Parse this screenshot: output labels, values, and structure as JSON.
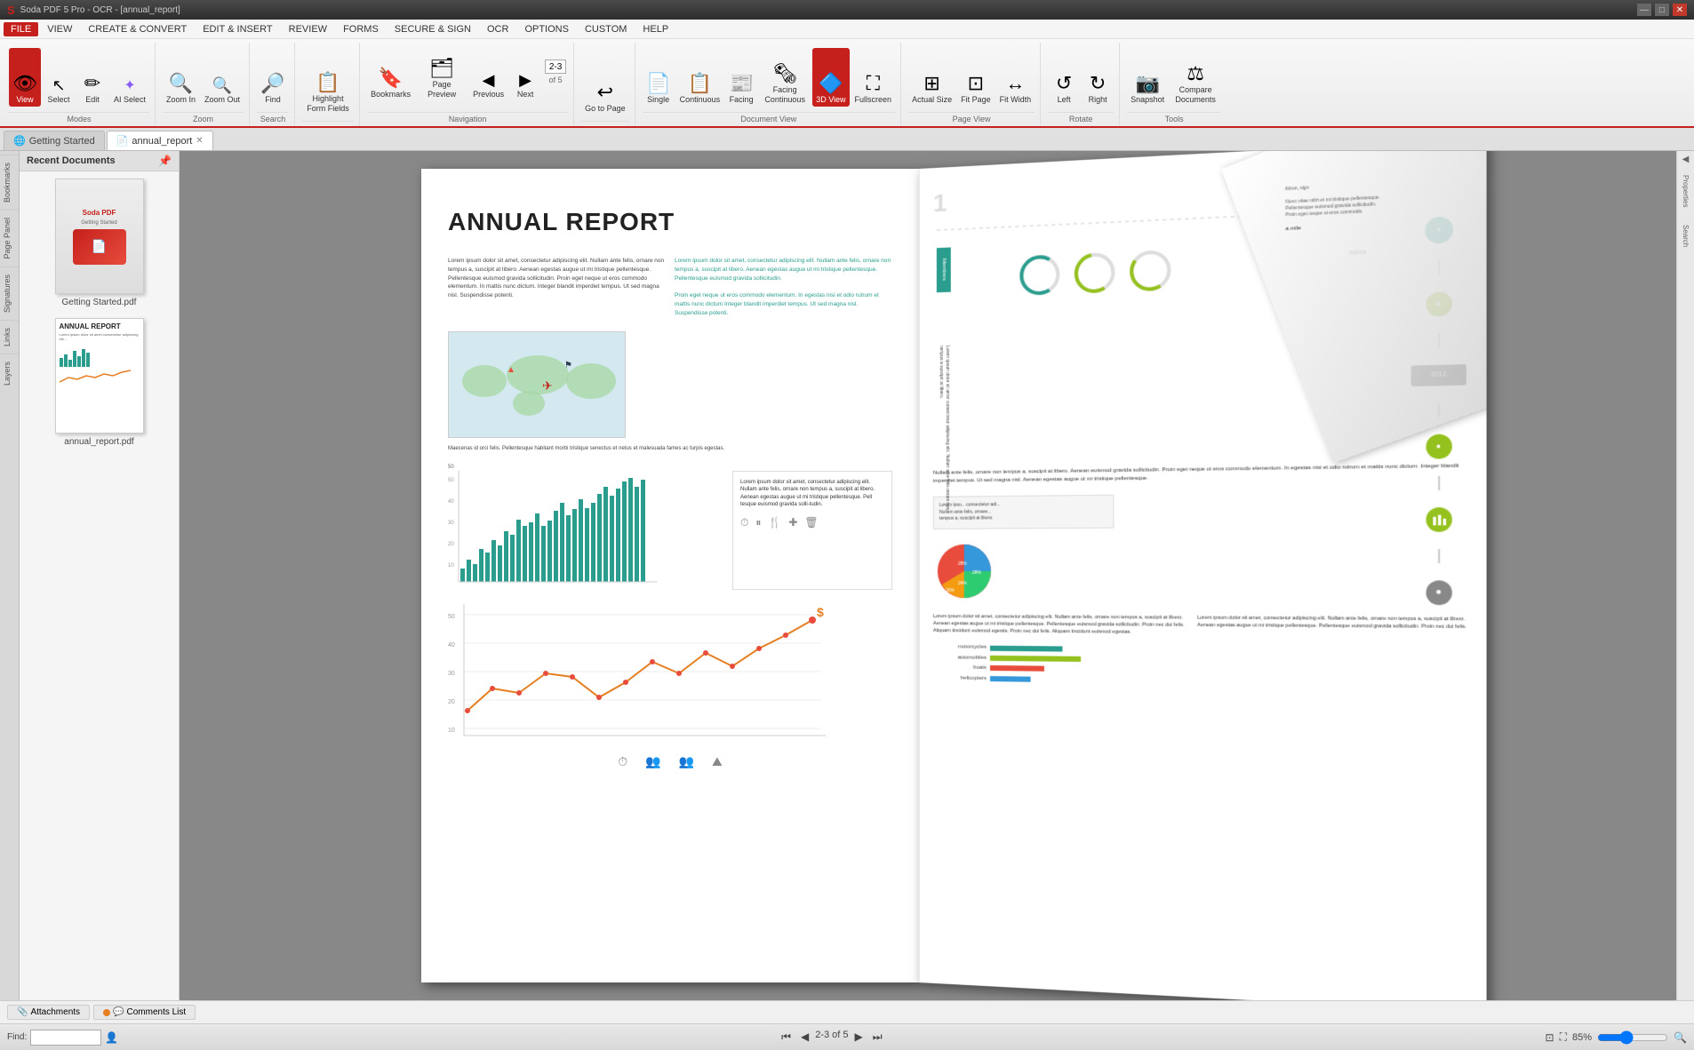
{
  "titlebar": {
    "title": "Soda PDF 5 Pro - OCR - [annual_report]",
    "app_name": "S",
    "minimize": "—",
    "maximize": "□",
    "close": "✕"
  },
  "menubar": {
    "items": [
      "FILE",
      "VIEW",
      "CREATE & CONVERT",
      "EDIT & INSERT",
      "REVIEW",
      "FORMS",
      "SECURE & SIGN",
      "OCR",
      "OPTIONS",
      "CUSTOM",
      "HELP"
    ]
  },
  "ribbon": {
    "groups": [
      {
        "label": "Modes",
        "buttons": [
          {
            "id": "view",
            "label": "View",
            "icon": "👁",
            "active": true
          },
          {
            "id": "select",
            "label": "Select",
            "icon": "↖"
          },
          {
            "id": "edit",
            "label": "Edit",
            "icon": "✏"
          }
        ]
      },
      {
        "label": "Zoom",
        "buttons": [
          {
            "id": "zoom-in",
            "label": "Zoom In",
            "icon": "🔍"
          },
          {
            "id": "zoom-out",
            "label": "Zoom Out",
            "icon": "🔍"
          }
        ]
      },
      {
        "label": "Search",
        "buttons": [
          {
            "id": "find",
            "label": "Find",
            "icon": "🔎"
          }
        ]
      },
      {
        "label": "",
        "buttons": [
          {
            "id": "highlight-form",
            "label": "Highlight Form Fields",
            "icon": "📋"
          }
        ]
      },
      {
        "label": "Navigation",
        "buttons": [
          {
            "id": "bookmarks",
            "label": "Bookmarks",
            "icon": "🔖"
          },
          {
            "id": "page-preview",
            "label": "Page Preview",
            "icon": "📄"
          },
          {
            "id": "previous",
            "label": "Previous",
            "icon": "◀"
          },
          {
            "id": "next",
            "label": "Next",
            "icon": "▶"
          }
        ],
        "nav_value": "2-3",
        "nav_of": "of 5"
      },
      {
        "label": "",
        "buttons": [
          {
            "id": "go-to-page",
            "label": "Go to Page",
            "icon": "↩"
          }
        ]
      },
      {
        "label": "Document View",
        "buttons": [
          {
            "id": "single",
            "label": "Single",
            "icon": "📄"
          },
          {
            "id": "continuous",
            "label": "Continuous",
            "icon": "📄"
          },
          {
            "id": "facing",
            "label": "Facing",
            "icon": "📰"
          },
          {
            "id": "facing-continuous",
            "label": "Facing Continuous",
            "icon": "📰"
          },
          {
            "id": "3d-view",
            "label": "3D View",
            "icon": "🔷",
            "active": true
          },
          {
            "id": "fullscreen",
            "label": "Fullscreen",
            "icon": "⛶"
          }
        ]
      },
      {
        "label": "Page View",
        "buttons": [
          {
            "id": "actual-size",
            "label": "Actual Size",
            "icon": "⊞"
          },
          {
            "id": "fit-page",
            "label": "Fit Page",
            "icon": "⊡"
          },
          {
            "id": "fit-width",
            "label": "Fit Width",
            "icon": "↔"
          }
        ]
      },
      {
        "label": "Rotate",
        "buttons": [
          {
            "id": "left",
            "label": "Left",
            "icon": "↺"
          },
          {
            "id": "right",
            "label": "Right",
            "icon": "↻"
          }
        ]
      },
      {
        "label": "Tools",
        "buttons": [
          {
            "id": "snapshot",
            "label": "Snapshot",
            "icon": "📷"
          },
          {
            "id": "compare",
            "label": "Compare Documents",
            "icon": "⚖"
          }
        ]
      }
    ]
  },
  "tabs": [
    {
      "id": "getting-started",
      "label": "Getting Started",
      "icon": "🌐",
      "closeable": false
    },
    {
      "id": "annual-report",
      "label": "annual_report",
      "icon": "📄",
      "closeable": true,
      "active": true
    }
  ],
  "recent_docs": {
    "header": "Recent Documents",
    "items": [
      {
        "name": "Getting Started.pdf",
        "type": "getting-started"
      },
      {
        "name": "annual_report.pdf",
        "type": "annual"
      }
    ]
  },
  "vsidebar": {
    "items": [
      "Bookmarks",
      "Page Panel",
      "Signatures",
      "Links",
      "Layers"
    ]
  },
  "document": {
    "title": "ANNUAL REPORT",
    "body_text": "Lorem ipsum dolor sit amet, consectetur adipiscing elit. Nullam ante felis, ornare non tempus a, suscipit at libero. Aenean egestas augue ut mi tristique pellentesque. Pellentesque euismod gravida sollicitudin. Proin eget neque ut eros commodo elementum. In mattis nunc dictum. Integer blandit imperdiet tempus. Ut sed magna nisl. Suspendisse potenti.",
    "body_text2": "Maecenas id orci felis. Pellentesque habitant morbi tristique senectus et netus et malesuada fames ac turpis egestas.",
    "col2_text": "Lorem ipsum dolor sit amet, consectetur adipiscing elit. Nullam ante felis, ornare non tempus a, suscipit at libero. Aenean egestas augue ut mi tristique pellentesque. Pellentesque euismod gravida sollicitudin.",
    "col2_text2": "Proin eget neque ut eros commodo elementum. In egestas nisi et odio rutrum et mattis nunc dictum Integer blandit imperdiet tempus. Ut sed magna nisl. Suspendisse potenti."
  },
  "bars": [
    15,
    22,
    18,
    30,
    25,
    38,
    32,
    45,
    40,
    50,
    42,
    48,
    55,
    38,
    44,
    52,
    60,
    48,
    55,
    62,
    50,
    58,
    65,
    72,
    60,
    68,
    75,
    80,
    70,
    78
  ],
  "line_points": "10,110 40,85 70,90 100,70 130,75 160,95 190,80 220,60 250,70 280,50 310,65 340,45 370,30 400,20",
  "status": {
    "find_label": "Find:",
    "page_info": "2-3  of  5",
    "zoom_level": "85%"
  },
  "bottom_tabs": [
    {
      "label": "Attachments",
      "icon": "📎"
    },
    {
      "label": "Comments List",
      "icon": "💬",
      "dot": "orange"
    }
  ],
  "right_content": {
    "text1": "Nullam ante felis, ornare non tempus a, suscipit at libero. Aenean euismod gravida sollicitudin. Proin eget neque ut eros commodo elementum. In egestas nisi et odio rutrum et mattis nunc dictum. Integer blandit imperdiet tempus. Ut sed magna nisl. Aenean egestas augue ut mi tristique pellentesque. Pellentesque euismod gravida sollicitudin.",
    "text2": "Lorem ipsum dolor sit amet, consectetur adipiscing elit. Nullam ante felis, ornare non tempus a, suscipit at libero. Aenean egestas augue ut mi tristique pellentesque. Pellentesque euismod gravida sollicitudin. Proin eget neque ut eros commodo elementum. In mattis nunc dictum. Integer blandit imperdiet tempus.",
    "text3": "Lorem ipsum dolor sit amet, consectetur adipiscing elit. Nullam ante felis, ornare non tempus a, suscipit at libero. Aenean egestas augue ut mi tristique pellentesque. Pellentesque euismod gravida sollicitudin. Proin nec dui felis."
  },
  "ai_select": {
    "label": "AI Select",
    "icon": "✦"
  }
}
